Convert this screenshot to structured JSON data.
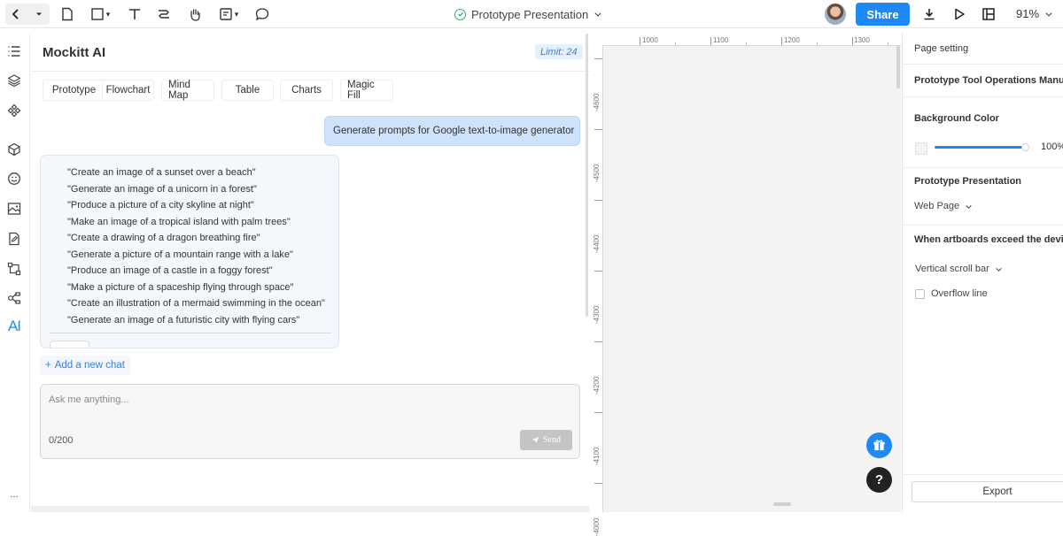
{
  "toolbar": {
    "doc_title": "Prototype Presentation",
    "share_label": "Share",
    "zoom": "91%"
  },
  "ai_panel": {
    "title": "Mockitt AI",
    "limit": "Limit: 24",
    "chips": [
      "Prototype",
      "Flowchart",
      "Mind Map",
      "Table",
      "Charts",
      "Magic Fill"
    ],
    "user_message": "Generate prompts for Google text-to-image generator",
    "prompts": [
      "\"Create an image of a sunset over a beach\"",
      "\"Generate an image of a unicorn in a forest\"",
      "\"Produce a picture of a city skyline at night\"",
      "\"Make an image of a tropical island with palm trees\"",
      "\"Create a drawing of a dragon breathing fire\"",
      "\"Generate a picture of a mountain range with a lake\"",
      "\"Produce an image of a castle in a foggy forest\"",
      "\"Make a picture of a spaceship flying through space\"",
      "\"Create an illustration of a mermaid swimming in the ocean\"",
      "\"Generate an image of a futuristic city with flying cars\""
    ],
    "new_chat_label": "Add a new chat",
    "input_placeholder": "Ask me anything...",
    "input_value": "",
    "counter": "0/200",
    "send_label": "Send"
  },
  "ruler": {
    "x_labels": [
      "1000",
      "1100",
      "1200",
      "1300"
    ],
    "y_labels": [
      "-4600",
      "-4500",
      "-4400",
      "-4300",
      "-4200",
      "-4100",
      "-4000"
    ]
  },
  "settings": {
    "page_setting": "Page setting",
    "manual_title": "Prototype Tool Operations Manual",
    "background_color_label": "Background Color",
    "opacity": "100%",
    "opacity_value": 1.0,
    "presentation_label": "Prototype Presentation",
    "presentation_value": "Web Page",
    "exceed_label": "When artboards exceed the device",
    "scroll_option": "Vertical scroll bar",
    "overflow_label": "Overflow line",
    "export_label": "Export"
  },
  "help_label": "?",
  "rail_more": "...",
  "rail_ai": "AI",
  "colors": {
    "accent": "#1e88f5",
    "user_bubble": "#cfe2fb",
    "bot_bubble": "#f4f7fb",
    "status_ok": "#2eae6a"
  }
}
